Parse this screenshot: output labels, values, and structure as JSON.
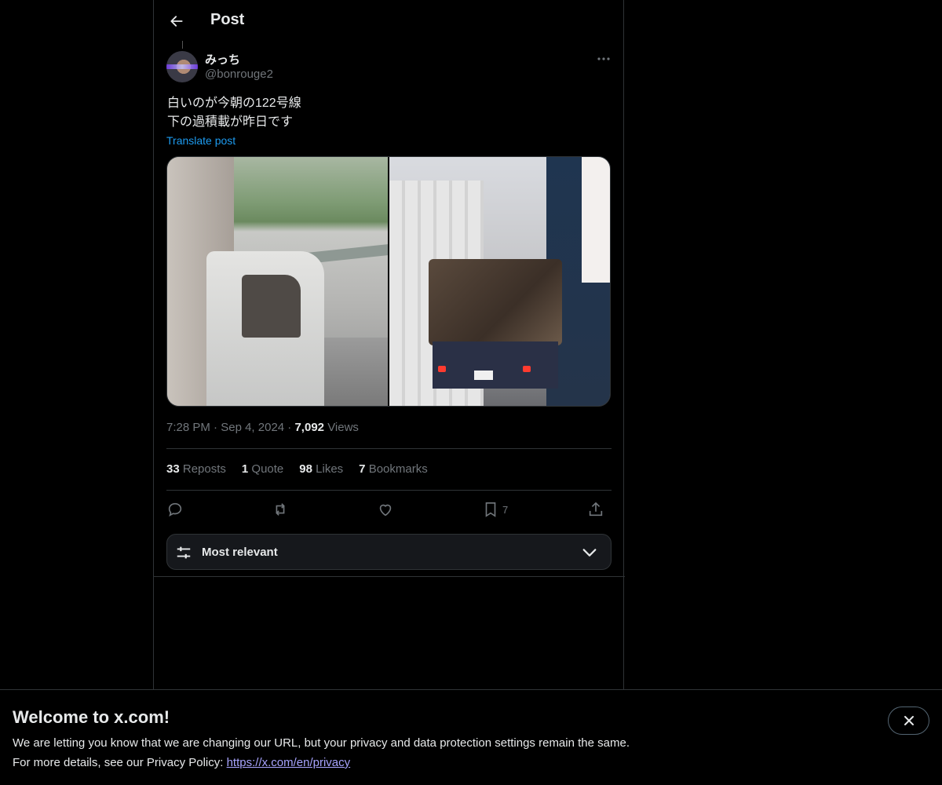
{
  "header": {
    "title": "Post"
  },
  "author": {
    "display_name": "みっち",
    "handle": "@bonrouge2"
  },
  "post": {
    "lines": [
      "白いのが今朝の122号線",
      "下の過積載が昨日です"
    ],
    "translate_label": "Translate post",
    "time": "7:28 PM",
    "date": "Sep 4, 2024",
    "views_count": "7,092",
    "views_label": "Views",
    "separator": "·"
  },
  "stats": {
    "reposts": {
      "count": "33",
      "label": "Reposts"
    },
    "quotes": {
      "count": "1",
      "label": "Quote"
    },
    "likes": {
      "count": "98",
      "label": "Likes"
    },
    "bookmarks": {
      "count": "7",
      "label": "Bookmarks"
    }
  },
  "actions": {
    "reply_icon": "reply-icon",
    "repost_icon": "repost-icon",
    "like_icon": "heart-icon",
    "bookmark_icon": "bookmark-icon",
    "bookmark_count": "7",
    "share_icon": "share-icon"
  },
  "sort": {
    "label": "Most relevant"
  },
  "banner": {
    "title": "Welcome to x.com!",
    "line1": "We are letting you know that we are changing our URL, but your privacy and data protection settings remain the same.",
    "line2_prefix": "For more details, see our Privacy Policy: ",
    "link": "https://x.com/en/privacy"
  },
  "colors": {
    "background": "#000000",
    "text": "#e7e9ea",
    "muted": "#71767b",
    "link": "#1d9bf0",
    "border": "#2f3336"
  }
}
